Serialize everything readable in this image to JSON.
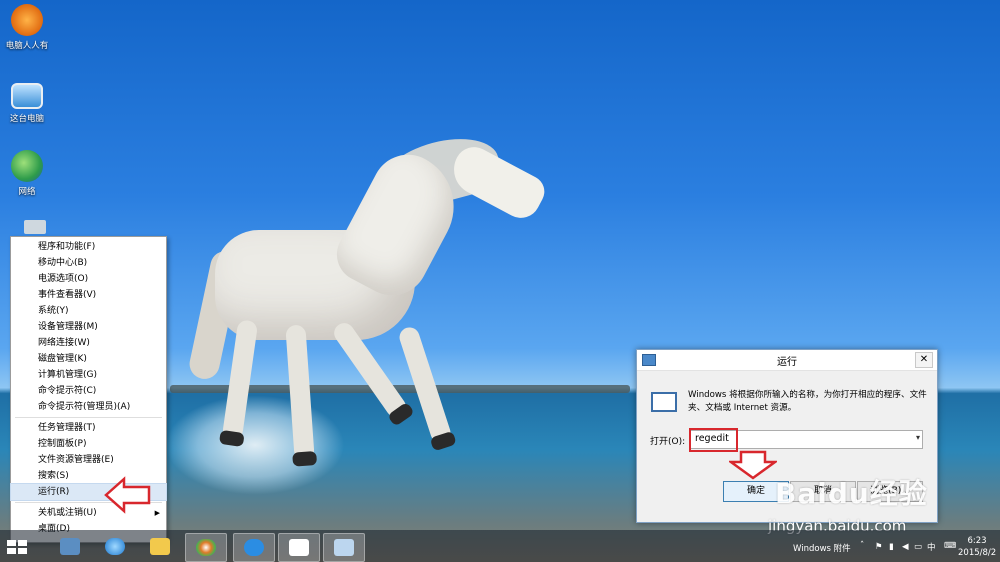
{
  "desktop": {
    "icons": [
      {
        "label": "电脑人人有",
        "color": "#e88a1e"
      },
      {
        "label": "这台电脑",
        "color": "#3a8fd8"
      },
      {
        "label": "网络",
        "color": "#2e9c4a"
      }
    ]
  },
  "winx_menu": {
    "items": [
      "程序和功能(F)",
      "移动中心(B)",
      "电源选项(O)",
      "事件查看器(V)",
      "系统(Y)",
      "设备管理器(M)",
      "网络连接(W)",
      "磁盘管理(K)",
      "计算机管理(G)",
      "命令提示符(C)",
      "命令提示符(管理员)(A)",
      "任务管理器(T)",
      "控制面板(P)",
      "文件资源管理器(E)",
      "搜索(S)",
      "运行(R)",
      "关机或注销(U)",
      "桌面(D)"
    ]
  },
  "run_dialog": {
    "title": "运行",
    "description": "Windows 将根据你所输入的名称，为你打开相应的程序、文件夹、文档或 Internet 资源。",
    "open_label": "打开(O):",
    "input_value": "regedit",
    "ok_label": "确定",
    "cancel_label": "取消",
    "browse_label": "浏览(B)..."
  },
  "taskbar": {
    "toolbar_label": "Windows 附件",
    "ime": "中",
    "time": "6:23",
    "date": "2015/8/2"
  },
  "watermark": {
    "brand": "Baidu经验",
    "url": "jingyan.baidu.com"
  },
  "colors": {
    "highlight_red": "#d8272d",
    "menu_highlight": "#dbe8f6"
  }
}
